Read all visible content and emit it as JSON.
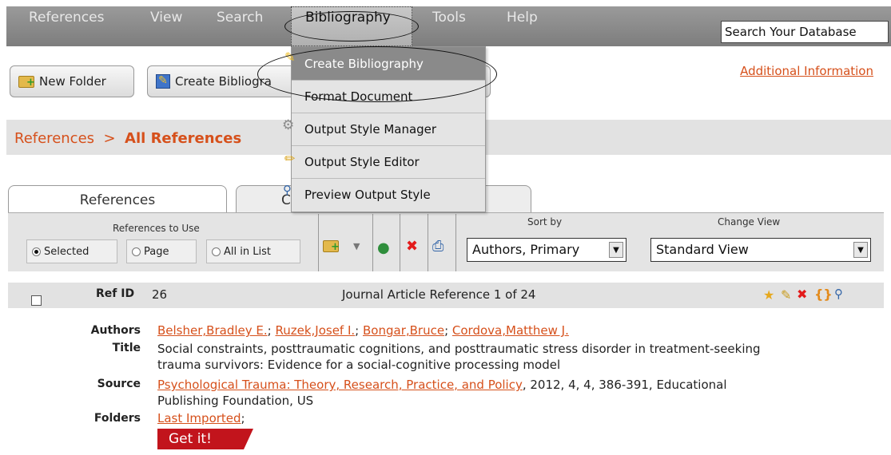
{
  "menu": {
    "items": [
      "References",
      "View",
      "Search",
      "Bibliography",
      "Tools",
      "Help"
    ],
    "search_value": "Search Your Database"
  },
  "toolbar": {
    "new_folder": "New Folder",
    "create_bibliography": "Create Bibliogra"
  },
  "additional_info": "Additional Information",
  "breadcrumb": {
    "root": "References",
    "separator": ">",
    "current": "All References"
  },
  "tabs": [
    "References",
    "C"
  ],
  "options": {
    "references_to_use": "References to Use",
    "radios": [
      {
        "label": "Selected",
        "checked": true
      },
      {
        "label": "Page",
        "checked": false
      },
      {
        "label": "All in List",
        "checked": false
      }
    ],
    "sort_by_label": "Sort by",
    "sort_by_value": "Authors, Primary",
    "change_view_label": "Change View",
    "change_view_value": "Standard View"
  },
  "dropdown": {
    "items": [
      {
        "label": "Create Bibliography",
        "icon": "create-bibliography-icon"
      },
      {
        "label": "Format Document",
        "icon": ""
      },
      {
        "label": "Output Style Manager",
        "icon": "gear-icon"
      },
      {
        "label": "Output Style Editor",
        "icon": "pencil-icon"
      },
      {
        "label": "Preview Output Style",
        "icon": "magnifier-icon"
      }
    ]
  },
  "record": {
    "ref_id_label": "Ref ID",
    "ref_id": "26",
    "header": "Journal Article Reference 1 of 24",
    "authors_label": "Authors",
    "authors": [
      "Belsher,Bradley E.",
      "Ruzek,Josef I.",
      "Bongar,Bruce",
      "Cordova,Matthew J."
    ],
    "title_label": "Title",
    "title": "Social constraints, posttraumatic cognitions, and posttraumatic stress disorder in treatment-seeking",
    "title_line2": "trauma survivors: Evidence for a social-cognitive processing model",
    "source_label": "Source",
    "source_link": "Psychological Trauma: Theory, Research, Practice, and Policy",
    "source_rest": ", 2012, 4, 4, 386-391, Educational",
    "source_line2": "Publishing Foundation, US",
    "folders_label": "Folders",
    "folder": "Last Imported",
    "get_it": "Get it!"
  },
  "colors": {
    "accent": "#d6501b",
    "menubar": "#8a8a8a",
    "get_it": "#c2141c"
  }
}
